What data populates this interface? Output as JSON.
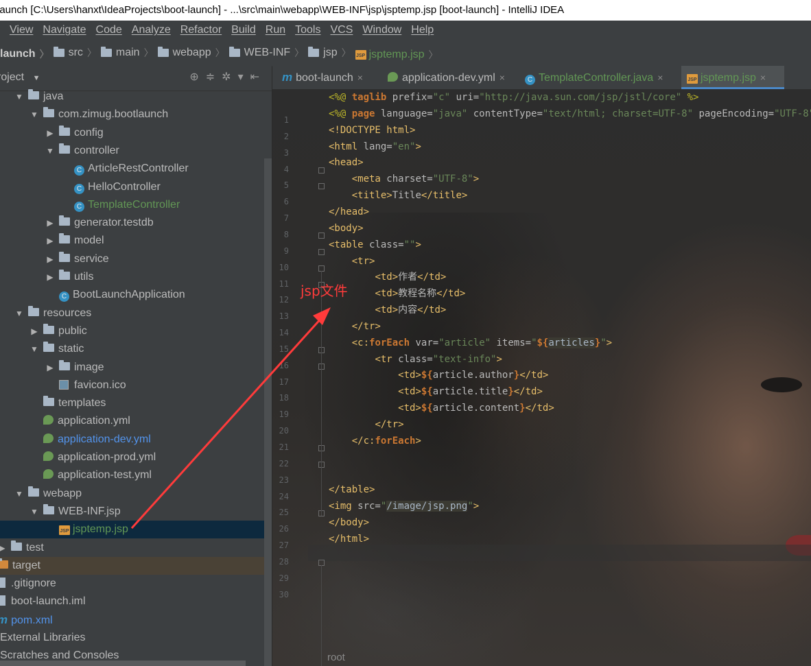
{
  "window": {
    "title": "launch [C:\\Users\\hanxt\\IdeaProjects\\boot-launch] - ...\\src\\main\\webapp\\WEB-INF\\jsp\\jsptemp.jsp [boot-launch] - IntelliJ IDEA"
  },
  "menu": [
    "View",
    "Navigate",
    "Code",
    "Analyze",
    "Refactor",
    "Build",
    "Run",
    "Tools",
    "VCS",
    "Window",
    "Help"
  ],
  "breadcrumb": [
    "launch",
    "src",
    "main",
    "webapp",
    "WEB-INF",
    "jsp",
    "jsptemp.jsp"
  ],
  "project_panel": {
    "title": "roject"
  },
  "tree": [
    {
      "label": "java",
      "indent": 1,
      "icon": "folder",
      "arrow": "down"
    },
    {
      "label": "com.zimug.bootlaunch",
      "indent": 2,
      "icon": "folder",
      "arrow": "down"
    },
    {
      "label": "config",
      "indent": 3,
      "icon": "folder",
      "arrow": "right"
    },
    {
      "label": "controller",
      "indent": 3,
      "icon": "folder",
      "arrow": "down"
    },
    {
      "label": "ArticleRestController",
      "indent": 4,
      "icon": "class"
    },
    {
      "label": "HelloController",
      "indent": 4,
      "icon": "class"
    },
    {
      "label": "TemplateController",
      "indent": 4,
      "icon": "class",
      "color": "green"
    },
    {
      "label": "generator.testdb",
      "indent": 3,
      "icon": "folder",
      "arrow": "right"
    },
    {
      "label": "model",
      "indent": 3,
      "icon": "folder",
      "arrow": "right"
    },
    {
      "label": "service",
      "indent": 3,
      "icon": "folder",
      "arrow": "right"
    },
    {
      "label": "utils",
      "indent": 3,
      "icon": "folder",
      "arrow": "right"
    },
    {
      "label": "BootLaunchApplication",
      "indent": 3,
      "icon": "class"
    },
    {
      "label": "resources",
      "indent": 1,
      "icon": "folder",
      "arrow": "down"
    },
    {
      "label": "public",
      "indent": 2,
      "icon": "folder",
      "arrow": "right"
    },
    {
      "label": "static",
      "indent": 2,
      "icon": "folder",
      "arrow": "down"
    },
    {
      "label": "image",
      "indent": 3,
      "icon": "folder",
      "arrow": "right"
    },
    {
      "label": "favicon.ico",
      "indent": 3,
      "icon": "ico"
    },
    {
      "label": "templates",
      "indent": 2,
      "icon": "folder"
    },
    {
      "label": "application.yml",
      "indent": 2,
      "icon": "yml"
    },
    {
      "label": "application-dev.yml",
      "indent": 2,
      "icon": "yml",
      "color": "blue"
    },
    {
      "label": "application-prod.yml",
      "indent": 2,
      "icon": "yml"
    },
    {
      "label": "application-test.yml",
      "indent": 2,
      "icon": "yml"
    },
    {
      "label": "webapp",
      "indent": 1,
      "icon": "folder",
      "arrow": "down"
    },
    {
      "label": "WEB-INF.jsp",
      "indent": 2,
      "icon": "folder",
      "arrow": "down"
    },
    {
      "label": "jsptemp.jsp",
      "indent": 3,
      "icon": "jsp",
      "selected": true,
      "color": "green"
    },
    {
      "label": "test",
      "indent": 0,
      "icon": "folder",
      "arrow": "right"
    },
    {
      "label": "target",
      "indent": 0,
      "icon": "folder-orange",
      "highlight": true
    },
    {
      "label": ".gitignore",
      "indent": 0,
      "icon": "file"
    },
    {
      "label": "boot-launch.iml",
      "indent": 0,
      "icon": "file"
    },
    {
      "label": "pom.xml",
      "indent": 0,
      "icon": "maven",
      "color": "blue"
    },
    {
      "label": "External Libraries",
      "indent": -1,
      "icon": "none"
    },
    {
      "label": "Scratches and Consoles",
      "indent": -1,
      "icon": "none"
    }
  ],
  "tabs": [
    {
      "label": "boot-launch",
      "icon": "maven"
    },
    {
      "label": "application-dev.yml",
      "icon": "yml"
    },
    {
      "label": "TemplateController.java",
      "icon": "class"
    },
    {
      "label": "jsptemp.jsp",
      "icon": "jsp",
      "active": true
    }
  ],
  "code_lines": [
    [
      [
        "dir",
        "<%@ "
      ],
      [
        "kw",
        "taglib"
      ],
      [
        "at",
        " prefix="
      ],
      [
        "sv",
        "\"c\""
      ],
      [
        "at",
        " uri="
      ],
      [
        "sv",
        "\"http://java.sun.com/jsp/jstl/core\""
      ],
      [
        "dir",
        " %>"
      ]
    ],
    [
      [
        "dir",
        "<%@ "
      ],
      [
        "kw",
        "page"
      ],
      [
        "at",
        " language="
      ],
      [
        "sv",
        "\"java\""
      ],
      [
        "at",
        " contentType="
      ],
      [
        "sv",
        "\"text/html; charset=UTF-8\""
      ],
      [
        "at",
        " pageEncoding="
      ],
      [
        "sv",
        "\"UTF-8\""
      ],
      [
        "dir",
        "%>"
      ]
    ],
    [
      [
        "tg",
        "<!DOCTYPE html>"
      ]
    ],
    [
      [
        "tg",
        "<html"
      ],
      [
        "at",
        " lang="
      ],
      [
        "sv",
        "\"en\""
      ],
      [
        "tg",
        ">"
      ]
    ],
    [
      [
        "tg",
        "<head>"
      ]
    ],
    [
      [
        "at",
        "    "
      ],
      [
        "tg",
        "<meta"
      ],
      [
        "at",
        " charset="
      ],
      [
        "sv",
        "\"UTF-8\""
      ],
      [
        "tg",
        ">"
      ]
    ],
    [
      [
        "at",
        "    "
      ],
      [
        "tg",
        "<title>"
      ],
      [
        "at",
        "Title"
      ],
      [
        "tg",
        "</title>"
      ]
    ],
    [
      [
        "tg",
        "</head>"
      ]
    ],
    [
      [
        "tg",
        "<body>"
      ]
    ],
    [
      [
        "tg",
        "<table"
      ],
      [
        "at",
        " class="
      ],
      [
        "sv",
        "\"\""
      ],
      [
        "tg",
        ">"
      ]
    ],
    [
      [
        "at",
        "    "
      ],
      [
        "tg",
        "<tr>"
      ]
    ],
    [
      [
        "at",
        "        "
      ],
      [
        "tg",
        "<td>"
      ],
      [
        "at",
        "作者"
      ],
      [
        "tg",
        "</td>"
      ]
    ],
    [
      [
        "at",
        "        "
      ],
      [
        "tg",
        "<td>"
      ],
      [
        "at",
        "教程名称"
      ],
      [
        "tg",
        "</td>"
      ]
    ],
    [
      [
        "at",
        "        "
      ],
      [
        "tg",
        "<td>"
      ],
      [
        "at",
        "内容"
      ],
      [
        "tg",
        "</td>"
      ]
    ],
    [
      [
        "at",
        "    "
      ],
      [
        "tg",
        "</tr>"
      ]
    ],
    [
      [
        "at",
        "    "
      ],
      [
        "tg",
        "<c:"
      ],
      [
        "kw",
        "forEach"
      ],
      [
        "at",
        " var="
      ],
      [
        "sv",
        "\"article\""
      ],
      [
        "at",
        " items="
      ],
      [
        "sv",
        "\""
      ],
      [
        "kw",
        "${"
      ],
      [
        "hl",
        "articles"
      ],
      [
        "kw",
        "}"
      ],
      [
        "sv",
        "\""
      ],
      [
        "tg",
        ">"
      ]
    ],
    [
      [
        "at",
        "        "
      ],
      [
        "tg",
        "<tr"
      ],
      [
        "at",
        " class="
      ],
      [
        "sv",
        "\"text-info\""
      ],
      [
        "tg",
        ">"
      ]
    ],
    [
      [
        "at",
        "            "
      ],
      [
        "tg",
        "<td>"
      ],
      [
        "kw",
        "${"
      ],
      [
        "at",
        "article.author"
      ],
      [
        "kw",
        "}"
      ],
      [
        "tg",
        "</td>"
      ]
    ],
    [
      [
        "at",
        "            "
      ],
      [
        "tg",
        "<td>"
      ],
      [
        "kw",
        "${"
      ],
      [
        "at",
        "article.title"
      ],
      [
        "kw",
        "}"
      ],
      [
        "tg",
        "</td>"
      ]
    ],
    [
      [
        "at",
        "            "
      ],
      [
        "tg",
        "<td>"
      ],
      [
        "kw",
        "${"
      ],
      [
        "at",
        "article.content"
      ],
      [
        "kw",
        "}"
      ],
      [
        "tg",
        "</td>"
      ]
    ],
    [
      [
        "at",
        "        "
      ],
      [
        "tg",
        "</tr>"
      ]
    ],
    [
      [
        "at",
        "    "
      ],
      [
        "tg",
        "</c:"
      ],
      [
        "kw",
        "forEach"
      ],
      [
        "tg",
        ">"
      ]
    ],
    [],
    [],
    [
      [
        "tg",
        "</table>"
      ]
    ],
    [
      [
        "tg",
        "<img"
      ],
      [
        "at",
        " src="
      ],
      [
        "sv",
        "\""
      ],
      [
        "hl",
        "/image/jsp.png"
      ],
      [
        "sv",
        "\""
      ],
      [
        "tg",
        ">"
      ]
    ],
    [
      [
        "tg",
        "</body>"
      ]
    ],
    [
      [
        "tg",
        "</html>"
      ]
    ],
    [],
    []
  ],
  "annotation": {
    "text": "jsp文件",
    "color": "#ff3b3b"
  },
  "status": {
    "path": "root"
  },
  "colors": {
    "accent": "#4a88c7",
    "selection": "#0d293e",
    "annotation_arrow": "#ff3b3b"
  }
}
